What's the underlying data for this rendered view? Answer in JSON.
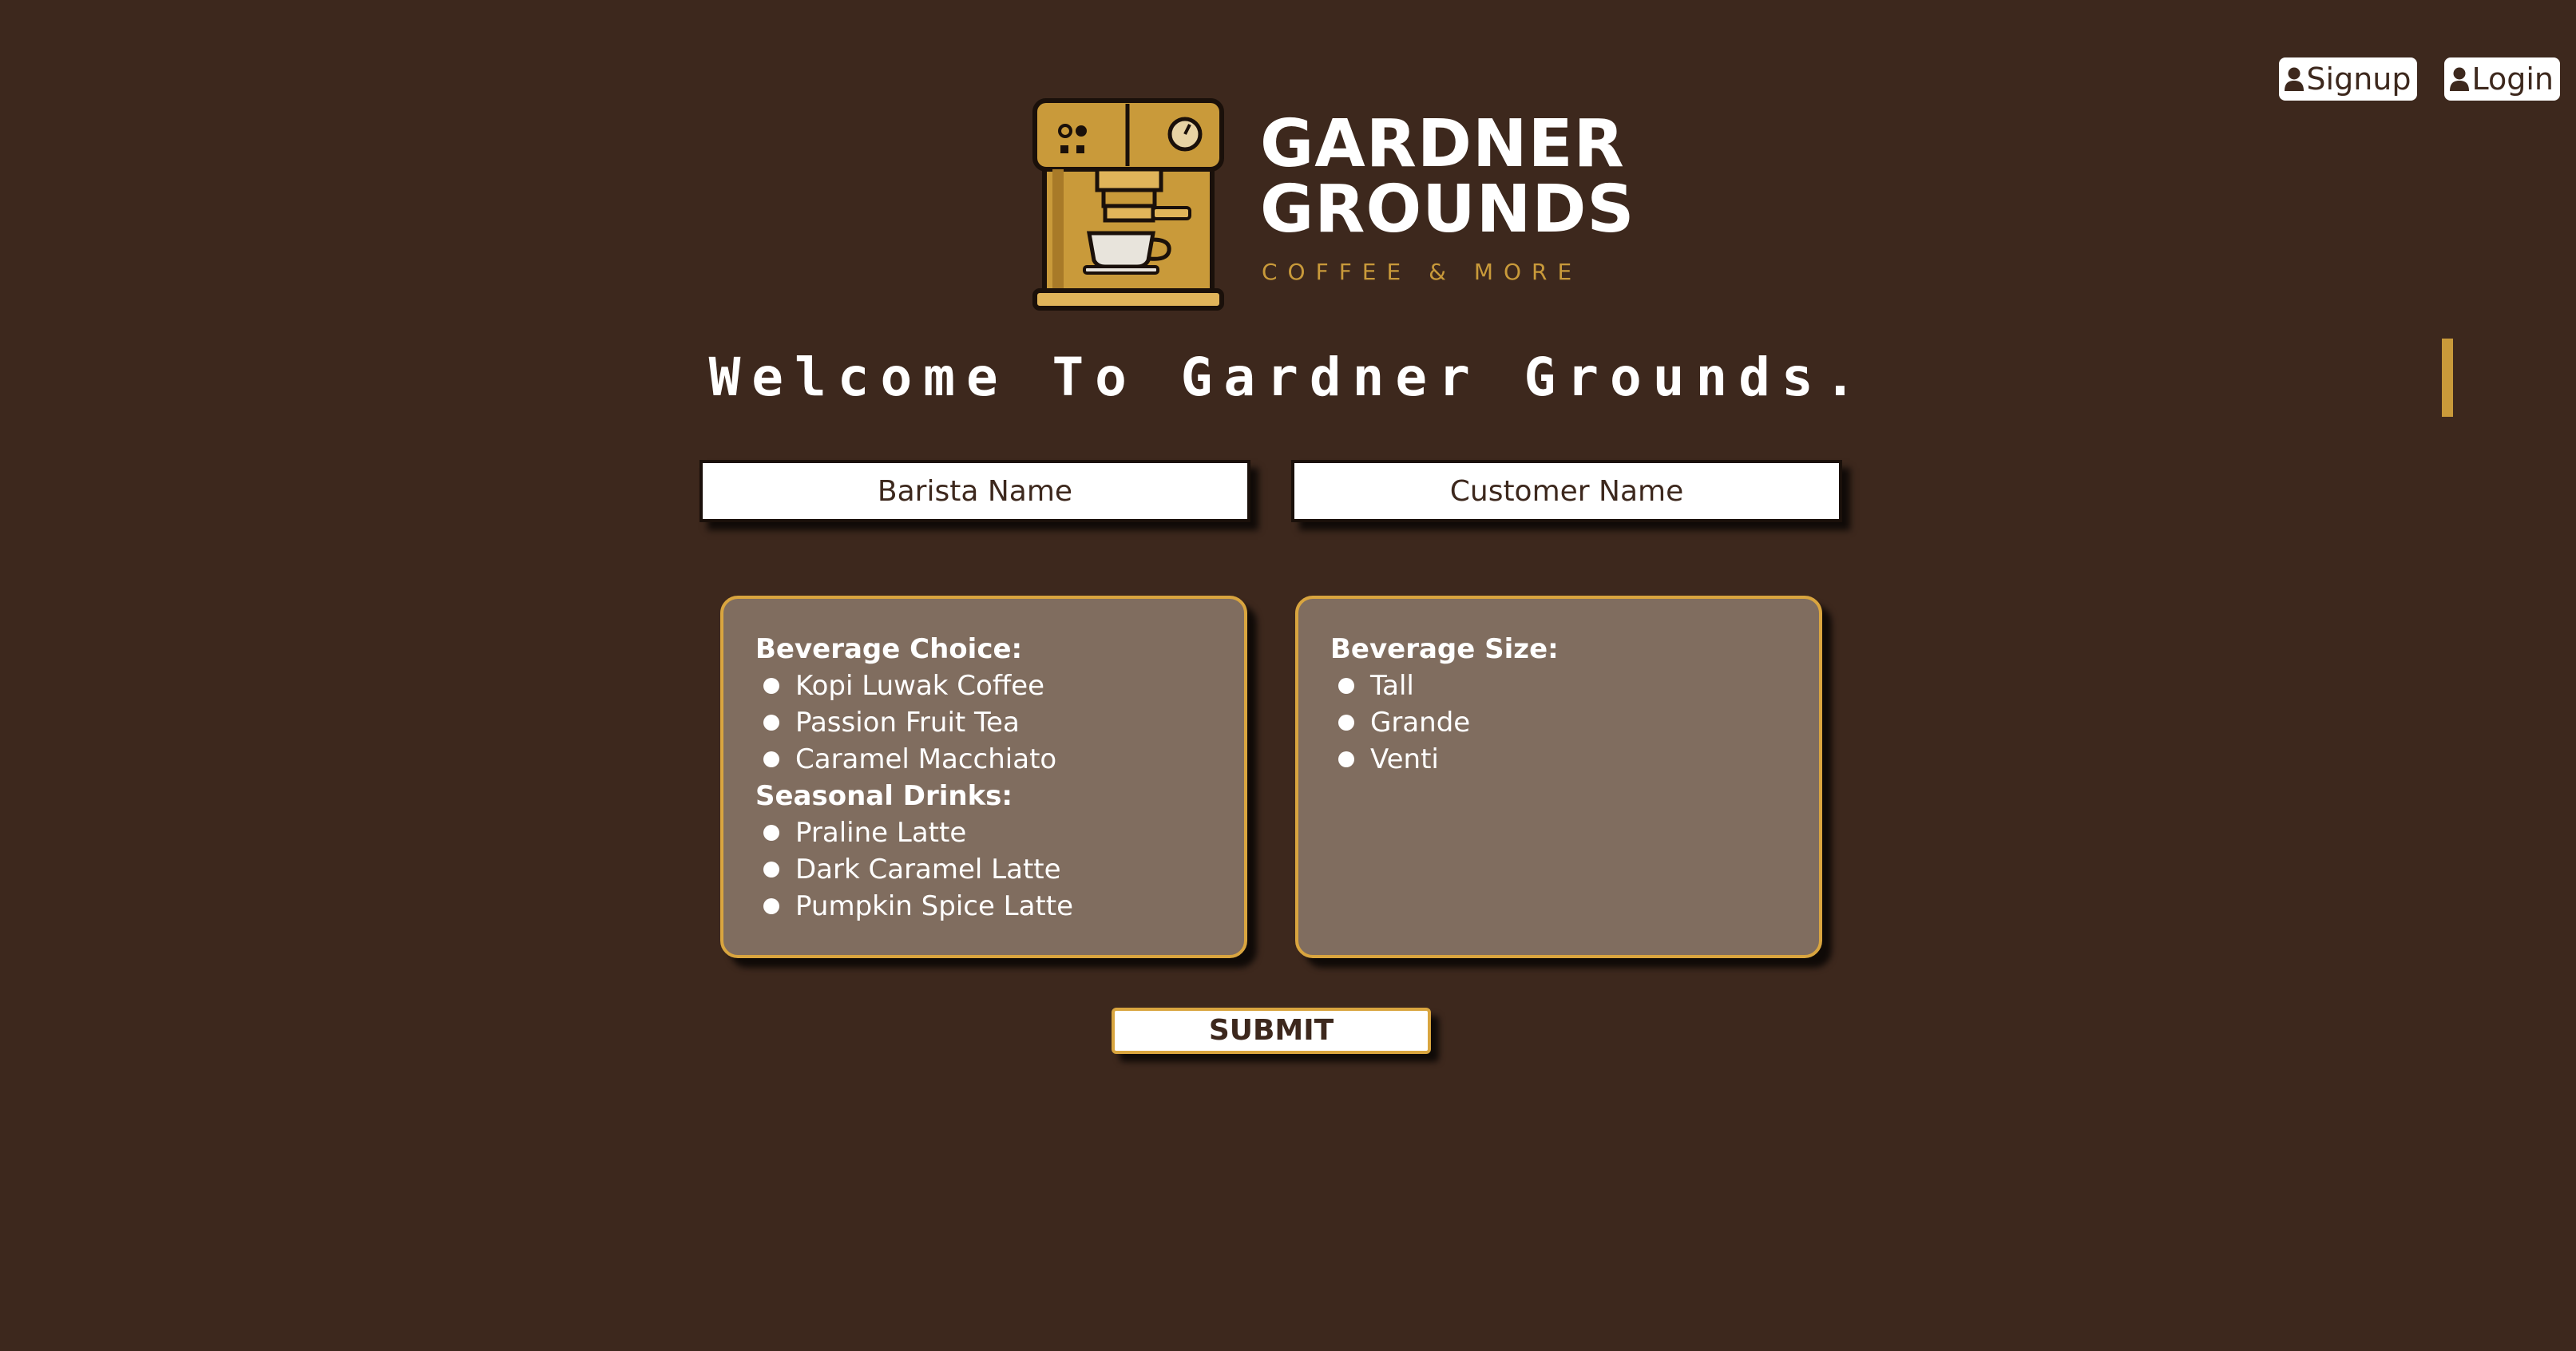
{
  "nav": {
    "signup_label": "Signup",
    "login_label": "Login",
    "icon": "user-icon"
  },
  "brand": {
    "line1": "GARDNER",
    "line2": "GROUNDS",
    "tagline": "COFFEE & MORE",
    "logo_icon": "espresso-machine-icon"
  },
  "welcome": "Welcome To Gardner Grounds.",
  "fields": {
    "barista_placeholder": "Barista Name",
    "customer_placeholder": "Customer Name"
  },
  "beverage": {
    "choice_title": "Beverage Choice:",
    "choices": [
      "Kopi Luwak Coffee",
      "Passion Fruit Tea",
      "Caramel Macchiato"
    ],
    "seasonal_title": "Seasonal Drinks:",
    "seasonal": [
      "Praline Latte",
      "Dark Caramel Latte",
      "Pumpkin Spice Latte"
    ]
  },
  "size": {
    "title": "Beverage Size:",
    "options": [
      "Tall",
      "Grande",
      "Venti"
    ]
  },
  "submit_label": "SUBMIT",
  "colors": {
    "background": "#3d281d",
    "accent_gold": "#d9a53f",
    "panel": "#806d5f",
    "text_dark": "#3d281d"
  }
}
